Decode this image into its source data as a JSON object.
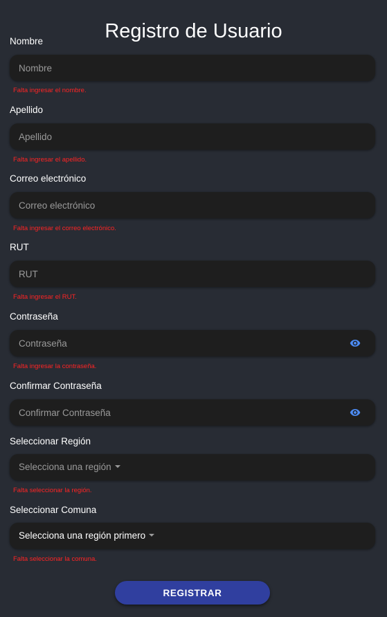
{
  "title": "Registro de Usuario",
  "fields": {
    "nombre": {
      "label": "Nombre",
      "placeholder": "Nombre",
      "error": "Falta ingresar el nombre."
    },
    "apellido": {
      "label": "Apellido",
      "placeholder": "Apellido",
      "error": "Falta ingresar el apellido."
    },
    "correo": {
      "label": "Correo electrónico",
      "placeholder": "Correo electrónico",
      "error": "Falta ingresar el correo electrónico."
    },
    "rut": {
      "label": "RUT",
      "placeholder": "RUT",
      "error": "Falta ingresar el RUT."
    },
    "contrasena": {
      "label": "Contraseña",
      "placeholder": "Contraseña",
      "error": "Falta ingresar la contraseña."
    },
    "confirmar": {
      "label": "Confirmar Contraseña",
      "placeholder": "Confirmar Contraseña"
    }
  },
  "selects": {
    "region": {
      "label": "Seleccionar Región",
      "value": "Selecciona una región",
      "error": "Falta seleccionar la región."
    },
    "comuna": {
      "label": "Seleccionar Comuna",
      "value": "Selecciona una región primero",
      "error": "Falta seleccionar la comuna."
    }
  },
  "submit_label": "REGISTRAR",
  "icons": {
    "password_toggle": "eye-icon",
    "dropdown": "caret-down-icon"
  },
  "colors": {
    "background": "#282c34",
    "field_background": "#1e1e1e",
    "error": "#ff2424",
    "button": "#303f9f",
    "eye_icon": "#4c8cf5",
    "placeholder": "#9a9a9a"
  }
}
